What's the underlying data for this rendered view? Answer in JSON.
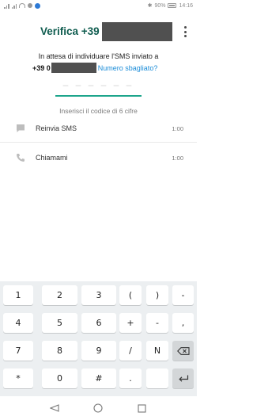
{
  "status_bar": {
    "battery_text": "90%",
    "time": "14:16"
  },
  "header": {
    "title": "Verifica +39",
    "menu_icon": "more-vert-icon"
  },
  "message": {
    "line1": "In attesa di individuare l'SMS inviato a",
    "phone_prefix": "+39 0",
    "wrong_number_link": "Numero sbagliato?"
  },
  "code_input": {
    "placeholder": "– – –  – – –",
    "hint": "Inserisci il codice di 6 cifre"
  },
  "options": [
    {
      "label": "Reinvia SMS",
      "time": "1:00",
      "icon": "sms-icon"
    },
    {
      "label": "Chiamami",
      "time": "1:00",
      "icon": "phone-icon"
    }
  ],
  "keyboard": {
    "rows": [
      [
        "1",
        "2",
        "3",
        "(",
        ")",
        "-"
      ],
      [
        "4",
        "5",
        "6",
        "+",
        "-",
        ","
      ],
      [
        "7",
        "8",
        "9",
        "/",
        "N",
        "backspace"
      ],
      [
        "*",
        "0",
        "#",
        ".",
        "",
        "enter"
      ]
    ]
  },
  "navbar": {
    "icons": [
      "back-icon",
      "home-icon",
      "recents-icon"
    ]
  },
  "colors": {
    "title": "#0f5c4f",
    "accent": "#1da58c",
    "link": "#1a8cd8"
  }
}
